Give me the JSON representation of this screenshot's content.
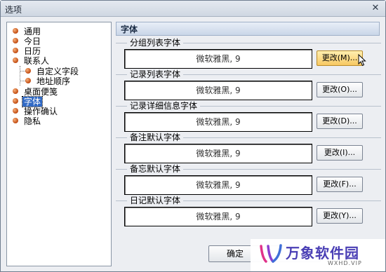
{
  "window": {
    "title": "选项",
    "close_glyph": "✕"
  },
  "nav": {
    "items": [
      {
        "label": "通用"
      },
      {
        "label": "今日"
      },
      {
        "label": "日历"
      },
      {
        "label": "联系人"
      },
      {
        "label": "自定义字段"
      },
      {
        "label": "地址顺序"
      },
      {
        "label": "桌面便笺"
      },
      {
        "label": "字体",
        "selected": true
      },
      {
        "label": "操作确认"
      },
      {
        "label": "隐私"
      }
    ]
  },
  "section": {
    "title": "字体"
  },
  "groups": [
    {
      "title": "分组列表字体",
      "font": "微软雅黑, 9",
      "button": "更改(M)..."
    },
    {
      "title": "记录列表字体",
      "font": "微软雅黑, 9",
      "button": "更改(O)..."
    },
    {
      "title": "记录详细信息字体",
      "font": "微软雅黑, 9",
      "button": "更改(D)..."
    },
    {
      "title": "备注默认字体",
      "font": "微软雅黑, 9",
      "button": "更改(I)..."
    },
    {
      "title": "备忘默认字体",
      "font": "微软雅黑, 9",
      "button": "更改(F)..."
    },
    {
      "title": "日记默认字体",
      "font": "微软雅黑, 9",
      "button": "更改(Y)..."
    }
  ],
  "footer": {
    "ok_label": "确定"
  },
  "watermark": {
    "name": "万象软件园",
    "url": "WXHD.VIP"
  }
}
